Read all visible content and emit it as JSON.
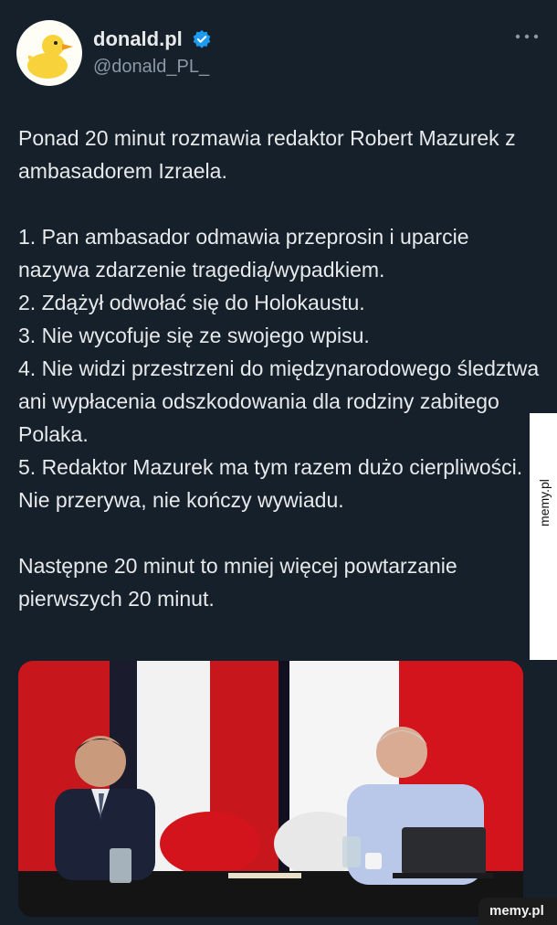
{
  "tweet": {
    "display_name": "donald.pl",
    "handle": "@donald_PL_",
    "verified": true,
    "avatar_icon": "duck-icon",
    "more_icon": "more-horizontal-icon",
    "text": {
      "intro": "Ponad 20 minut rozmawia redaktor Robert Mazurek z ambasadorem Izraela.",
      "points": [
        "1. Pan ambasador odmawia przeprosin i uparcie nazywa zdarzenie tragedią/wypadkiem.",
        "2. Zdążył odwołać się do Holokaustu.",
        "3. Nie wycofuje się ze swojego wpisu.",
        "4. Nie widzi przestrzeni do międzynarodowego śledztwa ani wypłacenia odszkodowania dla rodziny zabitego Polaka.",
        "5. Redaktor Mazurek ma tym razem dużo cierpliwości. Nie przerywa, nie kończy wywiadu."
      ],
      "outro": "Następne 20 minut to mniej więcej powtarzanie pierwszych 20 minut."
    }
  },
  "watermark": {
    "side": "memy.pl",
    "bottom": "memy.pl"
  },
  "colors": {
    "background": "#15202b",
    "text": "#e7e9ea",
    "secondary": "#8b98a5",
    "verified": "#1d9bf0"
  }
}
